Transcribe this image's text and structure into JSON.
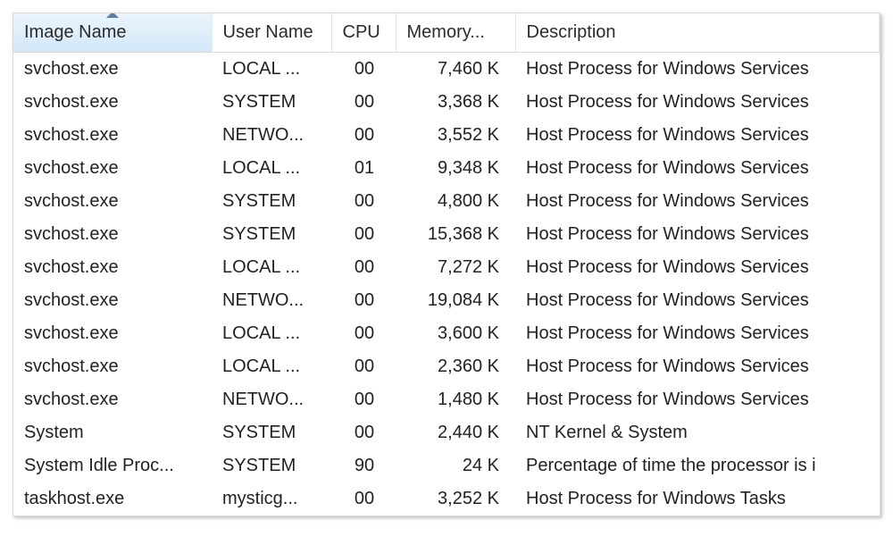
{
  "columns": {
    "image_name": "Image Name",
    "user_name": "User Name",
    "cpu": "CPU",
    "memory": "Memory...",
    "description": "Description"
  },
  "sort_column": "image_name",
  "rows": [
    {
      "image_name": "svchost.exe",
      "user_name": "LOCAL ...",
      "cpu": "00",
      "memory": "7,460 K",
      "description": "Host Process for Windows Services"
    },
    {
      "image_name": "svchost.exe",
      "user_name": "SYSTEM",
      "cpu": "00",
      "memory": "3,368 K",
      "description": "Host Process for Windows Services"
    },
    {
      "image_name": "svchost.exe",
      "user_name": "NETWO...",
      "cpu": "00",
      "memory": "3,552 K",
      "description": "Host Process for Windows Services"
    },
    {
      "image_name": "svchost.exe",
      "user_name": "LOCAL ...",
      "cpu": "01",
      "memory": "9,348 K",
      "description": "Host Process for Windows Services"
    },
    {
      "image_name": "svchost.exe",
      "user_name": "SYSTEM",
      "cpu": "00",
      "memory": "4,800 K",
      "description": "Host Process for Windows Services"
    },
    {
      "image_name": "svchost.exe",
      "user_name": "SYSTEM",
      "cpu": "00",
      "memory": "15,368 K",
      "description": "Host Process for Windows Services"
    },
    {
      "image_name": "svchost.exe",
      "user_name": "LOCAL ...",
      "cpu": "00",
      "memory": "7,272 K",
      "description": "Host Process for Windows Services"
    },
    {
      "image_name": "svchost.exe",
      "user_name": "NETWO...",
      "cpu": "00",
      "memory": "19,084 K",
      "description": "Host Process for Windows Services"
    },
    {
      "image_name": "svchost.exe",
      "user_name": "LOCAL ...",
      "cpu": "00",
      "memory": "3,600 K",
      "description": "Host Process for Windows Services"
    },
    {
      "image_name": "svchost.exe",
      "user_name": "LOCAL ...",
      "cpu": "00",
      "memory": "2,360 K",
      "description": "Host Process for Windows Services"
    },
    {
      "image_name": "svchost.exe",
      "user_name": "NETWO...",
      "cpu": "00",
      "memory": "1,480 K",
      "description": "Host Process for Windows Services"
    },
    {
      "image_name": "System",
      "user_name": "SYSTEM",
      "cpu": "00",
      "memory": "2,440 K",
      "description": "NT Kernel & System"
    },
    {
      "image_name": "System Idle Proc...",
      "user_name": "SYSTEM",
      "cpu": "90",
      "memory": "24 K",
      "description": "Percentage of time the processor is i"
    },
    {
      "image_name": "taskhost.exe",
      "user_name": "mysticg...",
      "cpu": "00",
      "memory": "3,252 K",
      "description": "Host Process for Windows Tasks"
    }
  ]
}
